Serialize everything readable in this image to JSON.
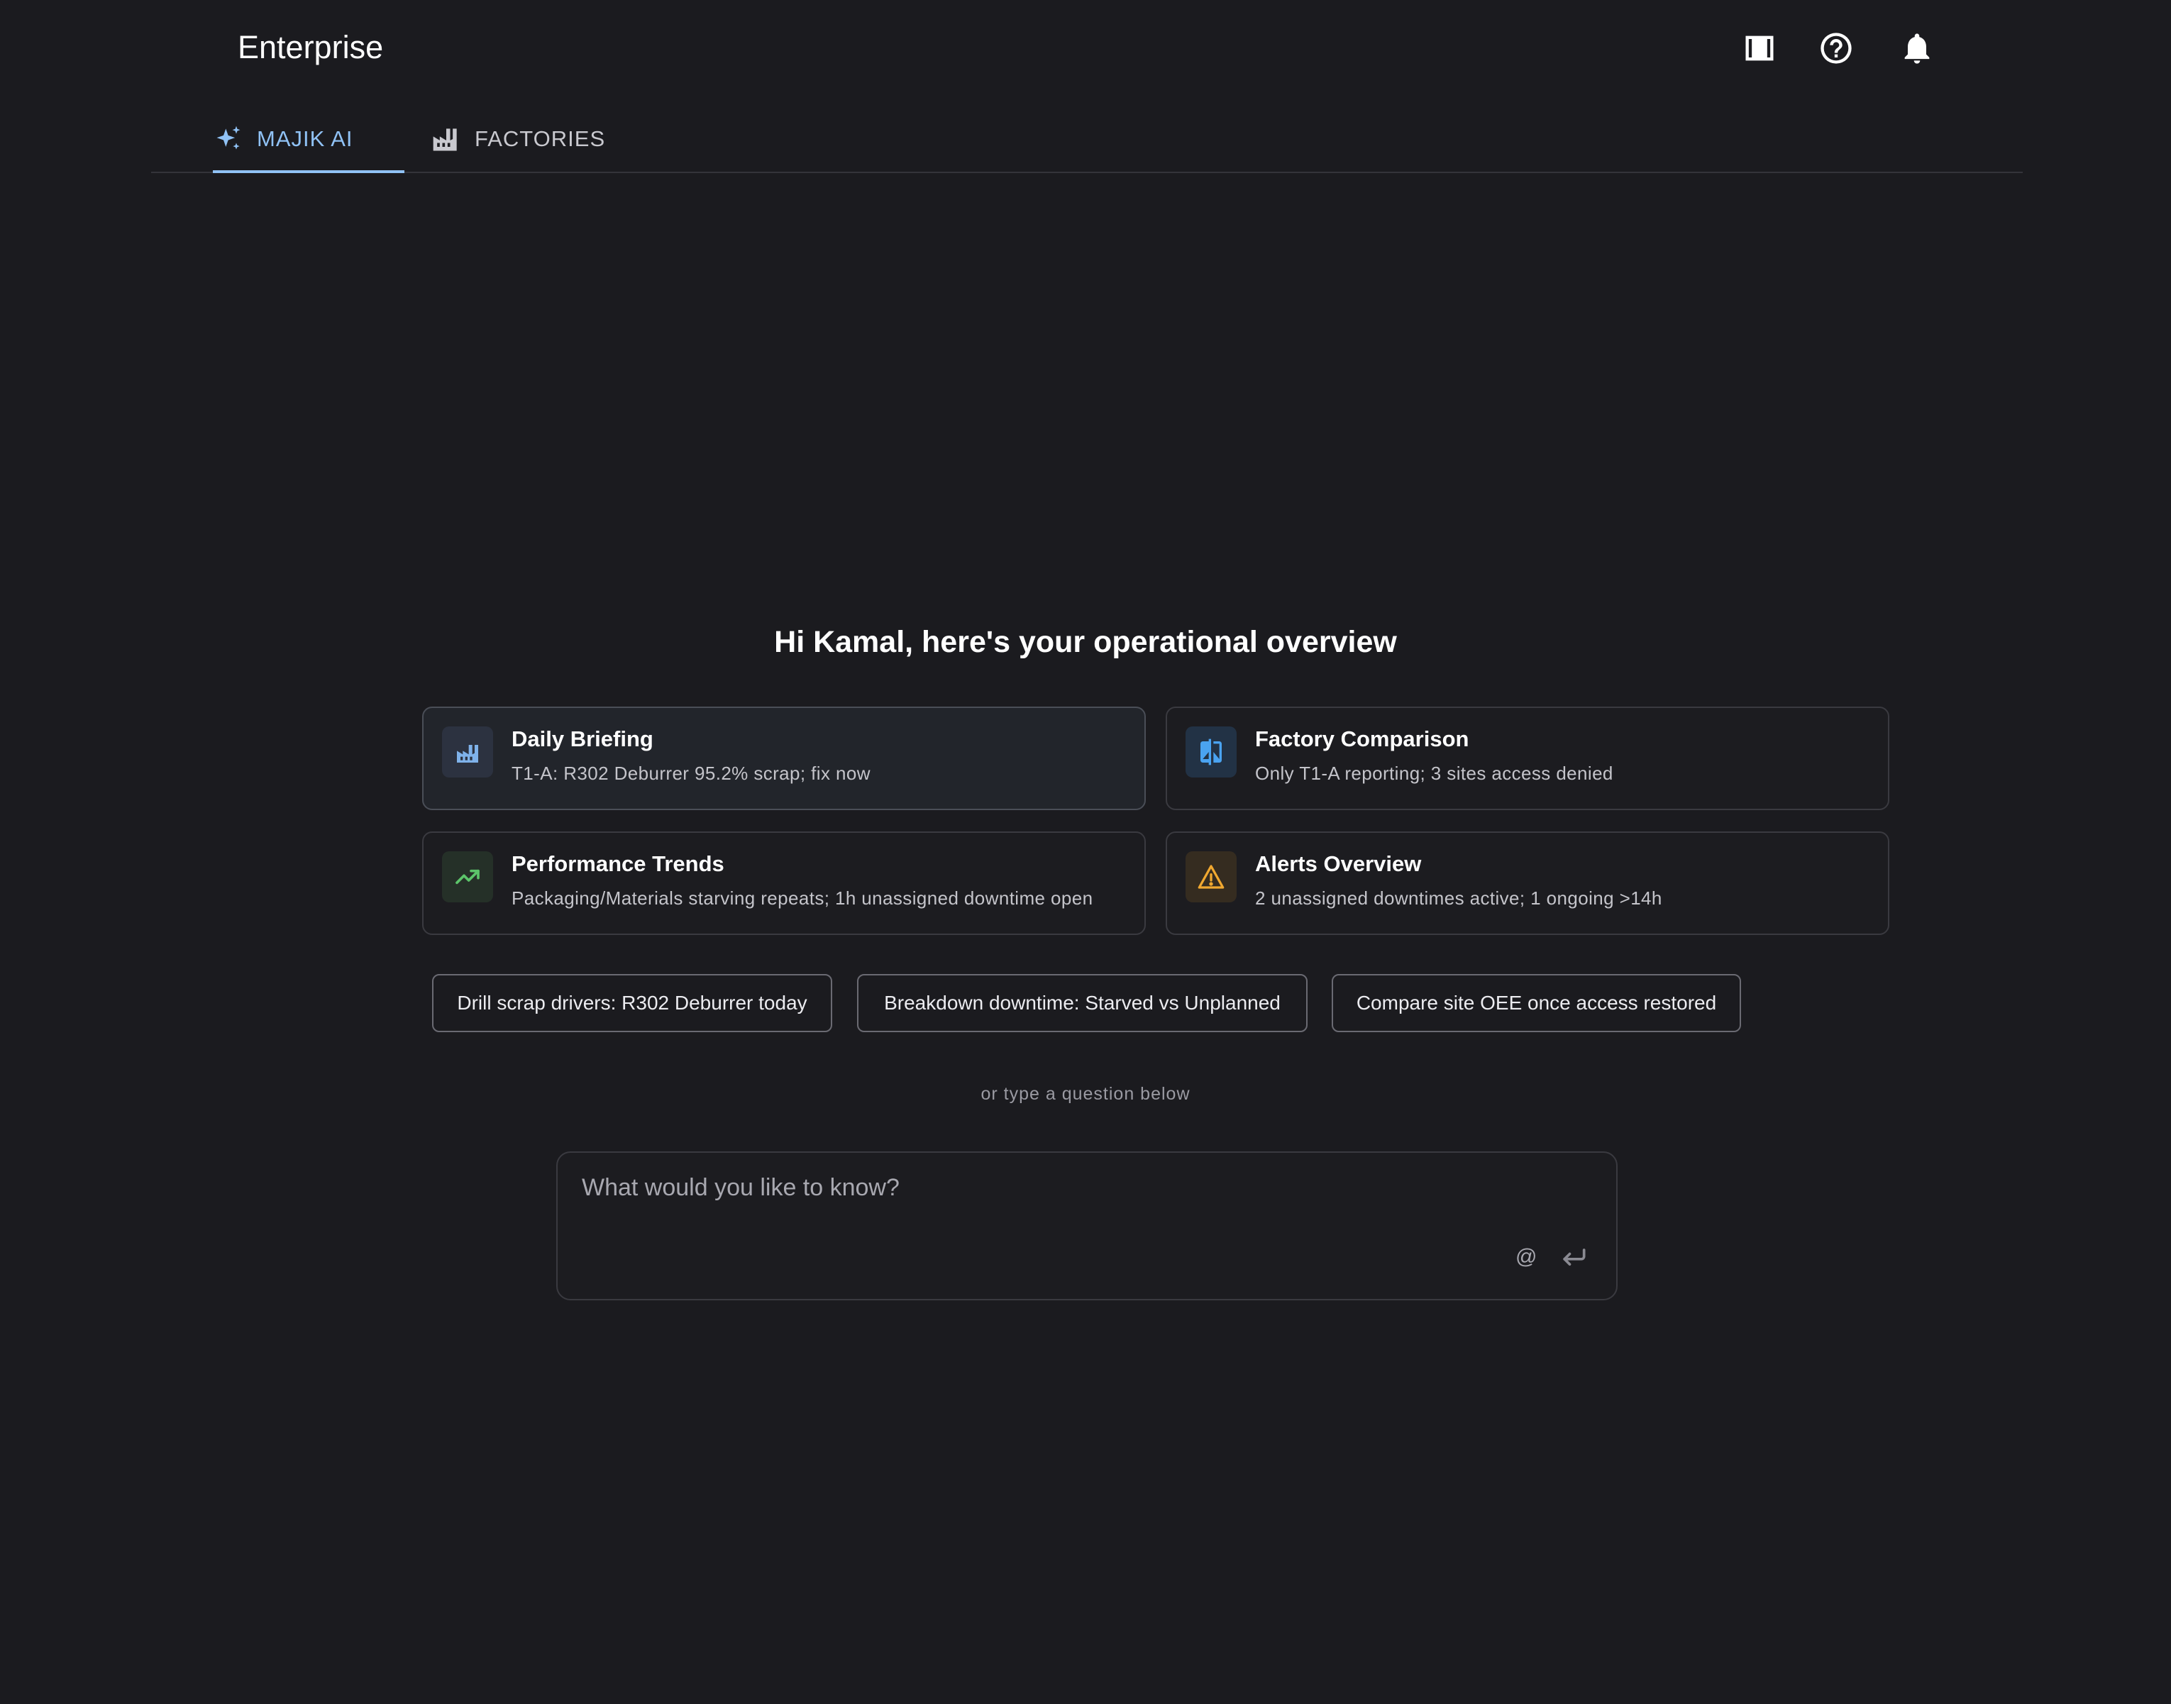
{
  "header": {
    "title": "Enterprise",
    "icons": [
      "panel-icon",
      "help-icon",
      "bell-icon"
    ]
  },
  "tabs": [
    {
      "label": "MAJIK AI",
      "icon": "sparkle-icon",
      "active": true
    },
    {
      "label": "FACTORIES",
      "icon": "factory-icon",
      "active": false
    }
  ],
  "greeting": "Hi Kamal, here's your operational overview",
  "cards": [
    {
      "title": "Daily Briefing",
      "subtitle": "T1-A: R302 Deburrer 95.2% scrap; fix now",
      "icon": "factory-icon",
      "color": "#7fb2ea"
    },
    {
      "title": "Factory Comparison",
      "subtitle": "Only T1-A reporting; 3 sites access denied",
      "icon": "compare-icon",
      "color": "#4aa3f0"
    },
    {
      "title": "Performance Trends",
      "subtitle": "Packaging/Materials starving repeats; 1h unassigned downtime open",
      "icon": "trending-up-icon",
      "color": "#5cc46a"
    },
    {
      "title": "Alerts Overview",
      "subtitle": "2 unassigned downtimes active; 1 ongoing >14h",
      "icon": "warning-icon",
      "color": "#f0a830"
    }
  ],
  "suggestions": [
    "Drill scrap drivers: R302 Deburrer today",
    "Breakdown downtime: Starved vs Unplanned",
    "Compare site OEE once access restored"
  ],
  "hint": "or type a question below",
  "ask": {
    "placeholder": "What would you like to know?",
    "mention_symbol": "@"
  },
  "colors": {
    "background": "#1b1b1f",
    "accent": "#90c2f5"
  }
}
